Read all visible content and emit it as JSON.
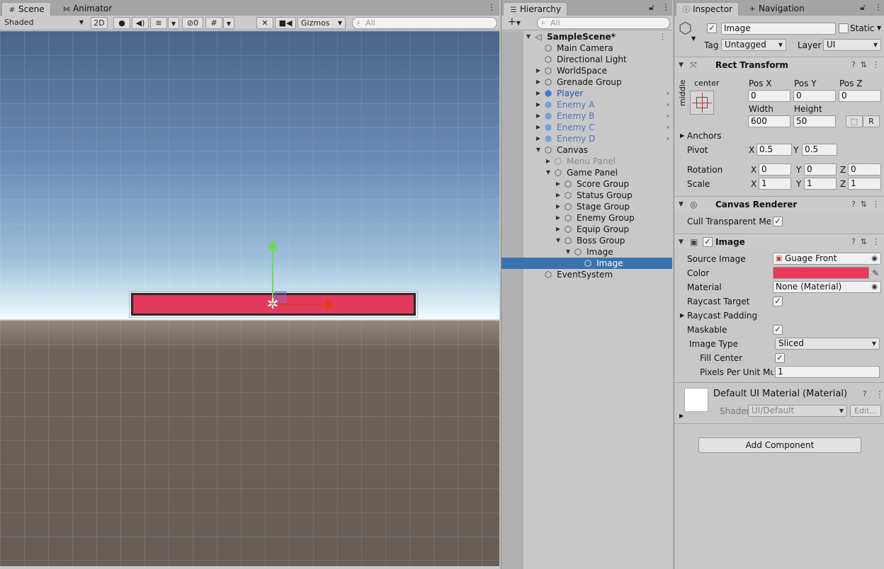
{
  "scene_panel": {
    "tabs": [
      {
        "label": "Scene",
        "icon": "hash-icon"
      },
      {
        "label": "Animator",
        "icon": "animator-icon"
      }
    ],
    "shading_mode": "Shaded",
    "toggle_2d": "2D",
    "hidden_count": "0",
    "gizmos_label": "Gizmos",
    "search_placeholder": "All"
  },
  "hierarchy": {
    "tab_label": "Hierarchy",
    "search_placeholder": "All",
    "scene_name": "SampleScene*",
    "items": [
      {
        "label": "Main Camera"
      },
      {
        "label": "Directional Light"
      },
      {
        "label": "WorldSpace"
      },
      {
        "label": "Grenade Group"
      },
      {
        "label": "Player"
      },
      {
        "label": "Enemy A"
      },
      {
        "label": "Enemy B"
      },
      {
        "label": "Enemy C"
      },
      {
        "label": "Enemy D"
      },
      {
        "label": "Canvas"
      },
      {
        "label": "Menu Panel"
      },
      {
        "label": "Game Panel"
      },
      {
        "label": "Score Group"
      },
      {
        "label": "Status Group"
      },
      {
        "label": "Stage Group"
      },
      {
        "label": "Enemy Group"
      },
      {
        "label": "Equip Group"
      },
      {
        "label": "Boss Group"
      },
      {
        "label": "Image"
      },
      {
        "label": "Image"
      },
      {
        "label": "EventSystem"
      }
    ]
  },
  "inspector": {
    "tabs": [
      "Inspector",
      "Navigation"
    ],
    "object_name": "Image",
    "static_label": "Static",
    "tag_label": "Tag",
    "tag_value": "Untagged",
    "layer_label": "Layer",
    "layer_value": "UI",
    "rect_transform": {
      "title": "Rect Transform",
      "anchor_h": "center",
      "anchor_v": "middle",
      "pos_x_label": "Pos X",
      "pos_y_label": "Pos Y",
      "pos_z_label": "Pos Z",
      "pos_x": "0",
      "pos_y": "0",
      "pos_z": "0",
      "width_label": "Width",
      "height_label": "Height",
      "width": "600",
      "height": "50",
      "r_button": "R",
      "anchors_label": "Anchors",
      "pivot_label": "Pivot",
      "pivot_x": "0.5",
      "pivot_y": "0.5",
      "rotation_label": "Rotation",
      "rot_x": "0",
      "rot_y": "0",
      "rot_z": "0",
      "scale_label": "Scale",
      "scale_x": "1",
      "scale_y": "1",
      "scale_z": "1",
      "x": "X",
      "y": "Y",
      "z": "Z"
    },
    "canvas_renderer": {
      "title": "Canvas Renderer",
      "cull_label": "Cull Transparent Mes"
    },
    "image": {
      "title": "Image",
      "source_image_label": "Source Image",
      "source_image_value": "Guage Front",
      "color_label": "Color",
      "color_value": "#e8395c",
      "material_label": "Material",
      "material_value": "None (Material)",
      "raycast_target_label": "Raycast Target",
      "raycast_padding_label": "Raycast Padding",
      "maskable_label": "Maskable",
      "image_type_label": "Image Type",
      "image_type_value": "Sliced",
      "fill_center_label": "Fill Center",
      "ppu_label": "Pixels Per Unit Mul",
      "ppu_value": "1"
    },
    "material": {
      "title": "Default UI Material (Material)",
      "shader_label": "Shader",
      "shader_value": "UI/Default",
      "edit_label": "Edit..."
    },
    "add_component": "Add Component"
  },
  "colors": {
    "health_bar": "#e3395c",
    "selection": "#3a72b0",
    "player_text": "#1f4fb8"
  }
}
